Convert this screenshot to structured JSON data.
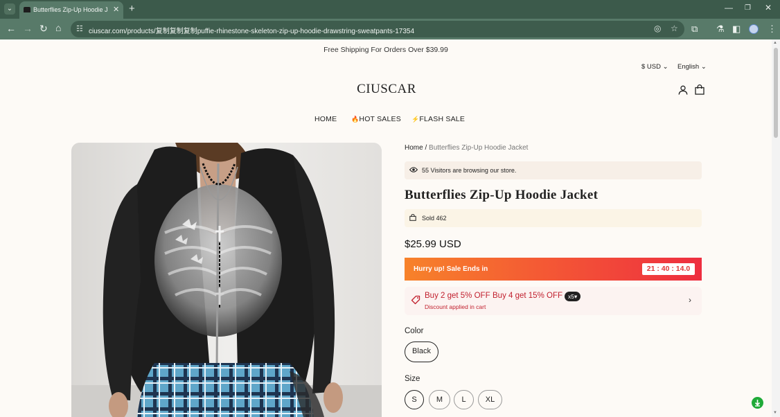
{
  "browser": {
    "tab_title": "Butterflies Zip-Up Hoodie Jacket",
    "url": "ciuscar.com/products/复制复制复制puffie-rhinestone-skeleton-zip-up-hoodie-drawstring-sweatpants-17354"
  },
  "store": {
    "announcement": "Free Shipping For Orders Over $39.99",
    "currency": "$ USD",
    "language": "English",
    "logo": "CIUSCAR",
    "menu": [
      {
        "label": "HOME",
        "emoji": ""
      },
      {
        "label": "HOT SALES",
        "emoji": "🔥"
      },
      {
        "label": "FLASH SALE",
        "emoji": "⚡"
      }
    ]
  },
  "product": {
    "breadcrumb": {
      "home": "Home",
      "separator": "/",
      "current": "Butterflies Zip-Up Hoodie Jacket"
    },
    "visitors": "55 Visitors are browsing our store.",
    "title": "Butterflies Zip-Up Hoodie Jacket",
    "sold": "Sold 462",
    "price": "$25.99 USD",
    "sale_banner": "Hurry up! Sale Ends in",
    "countdown": "21 : 40 : 14.0",
    "discount": {
      "offer1": "Buy 2 get 5% OFF",
      "offer2": "Buy 4 get 15% OFF",
      "qty_badge": "x5",
      "note": "Discount applied in cart"
    },
    "color_label": "Color",
    "colors": [
      "Black"
    ],
    "size_label": "Size",
    "sizes": [
      "S",
      "M",
      "L",
      "XL"
    ],
    "selected_size": "S"
  },
  "colors": {
    "chrome_dark": "#3c5a4b",
    "chrome": "#587a69",
    "page_bg": "#fdfaf6",
    "sale_gradient_start": "#f7822a",
    "sale_gradient_end": "#ee2e40",
    "discount_red": "#c11f2d",
    "chat_green": "#1faa38"
  }
}
